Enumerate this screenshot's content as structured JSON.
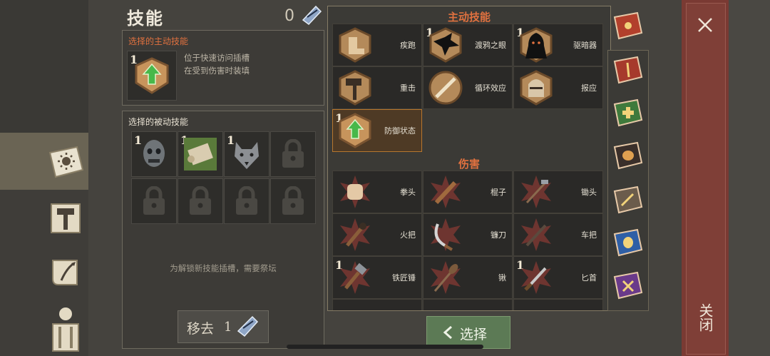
{
  "header": {
    "title": "技能",
    "gem_count": "0"
  },
  "active_box": {
    "heading": "选择的主动技能",
    "slot_level": "1",
    "desc_line1": "位于快速访问插槽",
    "desc_line2": "在受到伤害时装填"
  },
  "passive_box": {
    "heading": "选择的被动技能",
    "slots": [
      {
        "level": "1",
        "icon": "zombie-head-icon"
      },
      {
        "level": "1",
        "icon": "scroll-icon"
      },
      {
        "level": "1",
        "icon": "wolf-head-icon"
      },
      {
        "level": "",
        "icon": "lock-icon"
      }
    ],
    "locked_row_count_label": "",
    "hint": "为解锁新技能插槽，需要祭坛"
  },
  "active_skills": {
    "heading": "主动技能",
    "items": [
      {
        "label": "疾跑",
        "level": "",
        "icon": "boot-icon"
      },
      {
        "label": "渡鸦之眼",
        "level": "1",
        "icon": "raven-icon"
      },
      {
        "label": "驱暗器",
        "level": "1",
        "icon": "hooded-figure-icon"
      },
      {
        "label": "重击",
        "level": "",
        "icon": "hammer-icon"
      },
      {
        "label": "循环效应",
        "level": "",
        "icon": "sword-icon"
      },
      {
        "label": "报应",
        "level": "",
        "icon": "helmet-icon"
      },
      {
        "label": "防御状态",
        "level": "1",
        "icon": "shield-up-arrow-icon"
      }
    ]
  },
  "damage": {
    "heading": "伤害",
    "items": [
      {
        "label": "拳头",
        "level": "",
        "icon": "fist-icon"
      },
      {
        "label": "棍子",
        "level": "",
        "icon": "club-icon"
      },
      {
        "label": "锄头",
        "level": "",
        "icon": "hoe-icon"
      },
      {
        "label": "火把",
        "level": "",
        "icon": "torch-icon"
      },
      {
        "label": "镰刀",
        "level": "",
        "icon": "sickle-icon"
      },
      {
        "label": "车把",
        "level": "",
        "icon": "handlebar-icon"
      },
      {
        "label": "铁匠锤",
        "level": "1",
        "icon": "smith-hammer-icon"
      },
      {
        "label": "锹",
        "level": "",
        "icon": "shovel-icon"
      },
      {
        "label": "匕首",
        "level": "1",
        "icon": "dagger-icon"
      }
    ]
  },
  "buttons": {
    "remove_label": "移去",
    "remove_count": "1",
    "select_label": "选择",
    "close_label": "关闭"
  },
  "colors": {
    "accent_orange": "#e0713f",
    "close_red": "#7a3a33",
    "select_green": "#5c7a55"
  }
}
